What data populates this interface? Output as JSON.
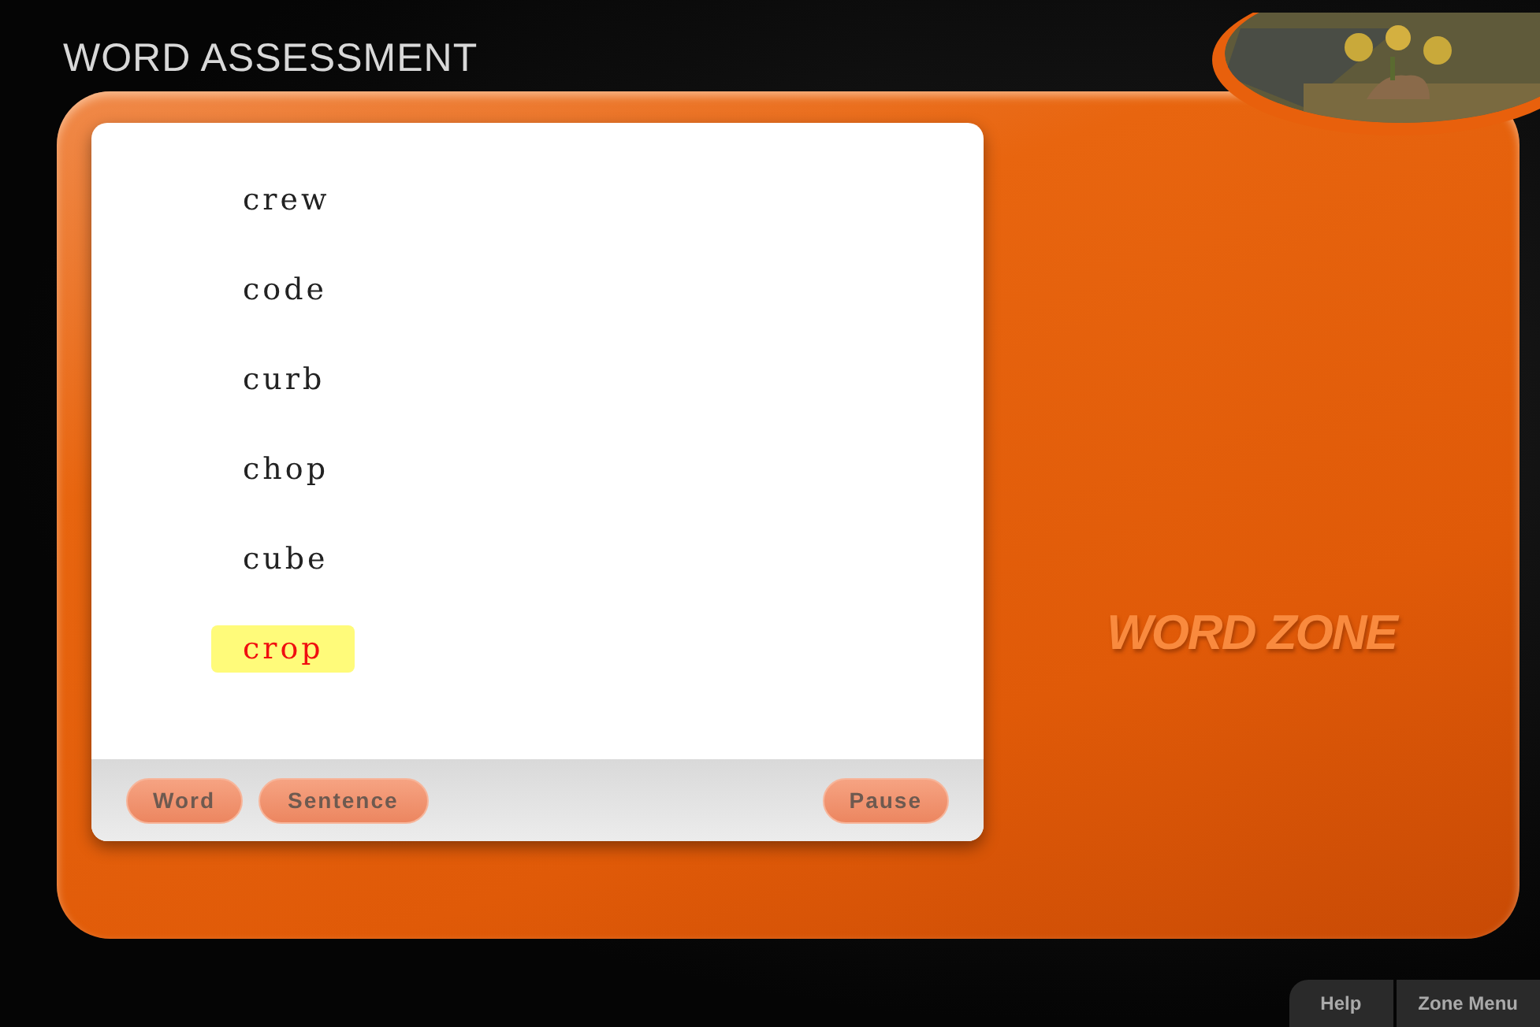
{
  "header": {
    "title": "WORD ASSESSMENT"
  },
  "words": [
    {
      "text": "crew",
      "selected": false
    },
    {
      "text": "code",
      "selected": false
    },
    {
      "text": "curb",
      "selected": false
    },
    {
      "text": "chop",
      "selected": false
    },
    {
      "text": "cube",
      "selected": false
    },
    {
      "text": "crop",
      "selected": true
    }
  ],
  "controls": [
    {
      "label": "Word",
      "disabled": true
    },
    {
      "label": "Sentence",
      "disabled": true
    },
    {
      "label": "Pause",
      "disabled": true
    }
  ],
  "zone_label": "WORD ZONE",
  "footer_tabs": [
    {
      "label": "Help"
    },
    {
      "label": "Zone Menu"
    }
  ]
}
